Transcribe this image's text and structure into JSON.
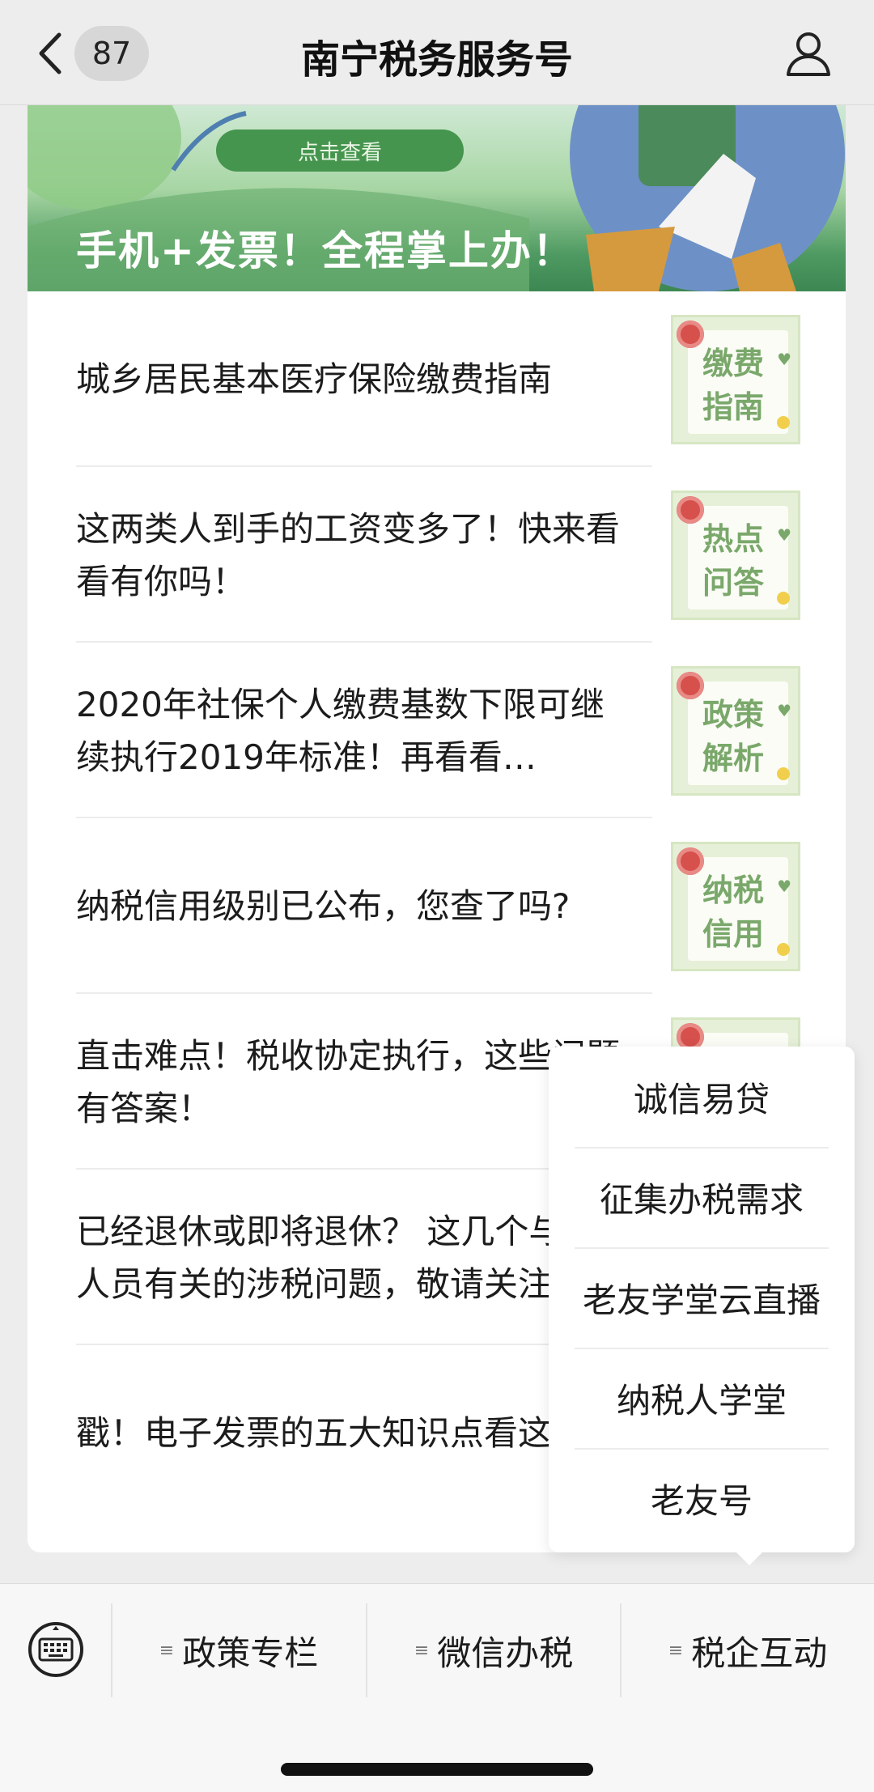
{
  "header": {
    "back_icon": "chevron-left-icon",
    "unread_count": "87",
    "title": "南宁税务服务号",
    "profile_icon": "person-icon"
  },
  "banner": {
    "button_label": "点击查看",
    "headline": "手机+发票！全程掌上办！"
  },
  "articles": [
    {
      "title": "城乡居民基本医疗保险缴费指南",
      "thumb_text": "缴费指南"
    },
    {
      "title": "这两类人到手的工资变多了！快来看看有你吗！",
      "thumb_text": "热点问答"
    },
    {
      "title": "2020年社保个人缴费基数下限可继续执行2019年标准！再看看…",
      "thumb_text": "政策解析"
    },
    {
      "title": "纳税信用级别已公布，您查了吗?",
      "thumb_text": "纳税信用"
    },
    {
      "title": "直击难点！税收协定执行，这些问题有答案！",
      "thumb_text": ""
    },
    {
      "title": "已经退休或即将退休？ 这几个与退休人员有关的涉税问题，敬请关注",
      "thumb_text": ""
    },
    {
      "title": "戳！电子发票的五大知识点看这里→",
      "thumb_text": ""
    }
  ],
  "popup_menu": {
    "items": [
      "诚信易贷",
      "征集办税需求",
      "老友学堂云直播",
      "纳税人学堂",
      "老友号"
    ]
  },
  "bottom_menu": {
    "keyboard_icon": "keyboard-icon",
    "items": [
      {
        "label": "政策专栏",
        "icon": "menu-lines-icon"
      },
      {
        "label": "微信办税",
        "icon": "menu-lines-icon"
      },
      {
        "label": "税企互动",
        "icon": "menu-lines-icon"
      }
    ]
  },
  "colors": {
    "background": "#ededed",
    "banner_green": "#46954f",
    "thumb_green": "#7aa86b",
    "card": "#ffffff"
  }
}
